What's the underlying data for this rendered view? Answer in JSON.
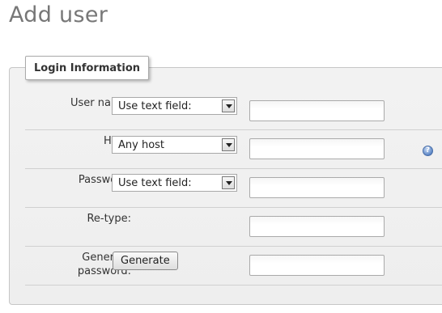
{
  "page": {
    "title": "Add user"
  },
  "login": {
    "legend": "Login Information",
    "username": {
      "label": "User name:",
      "select_value": "Use text field:",
      "value": ""
    },
    "host": {
      "label": "Host:",
      "select_value": "Any host",
      "value": "",
      "help_icon": "help-icon"
    },
    "password": {
      "label": "Password:",
      "select_value": "Use text field:",
      "value": ""
    },
    "retype": {
      "label": "Re-type:",
      "value": ""
    },
    "generate": {
      "label_line1": "Generate",
      "label_line2": "password:",
      "button": "Generate",
      "value": ""
    }
  }
}
